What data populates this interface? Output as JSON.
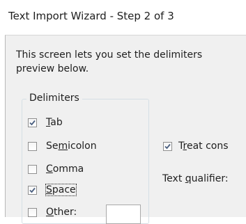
{
  "window": {
    "title": "Text Import Wizard - Step 2 of 3"
  },
  "intro": {
    "line1": "This screen lets you set the delimiters",
    "line2": "preview below."
  },
  "delimiters": {
    "group_label": "Delimiters",
    "items": [
      {
        "before": "",
        "mnemonic": "T",
        "after": "ab",
        "checked": true
      },
      {
        "before": "Se",
        "mnemonic": "m",
        "after": "icolon",
        "checked": false
      },
      {
        "before": "",
        "mnemonic": "C",
        "after": "omma",
        "checked": false
      },
      {
        "before": "",
        "mnemonic": "S",
        "after": "pace",
        "checked": true
      },
      {
        "before": "",
        "mnemonic": "O",
        "after": "ther:",
        "checked": false
      }
    ],
    "other_value": ""
  },
  "treat_consecutive": {
    "before": "T",
    "mnemonic": "r",
    "after": "eat cons",
    "checked": true
  },
  "text_qualifier": {
    "before": "Text ",
    "mnemonic": "q",
    "after": "ualifier:"
  },
  "colors": {
    "dialog_bg": "#f0f0f0",
    "title_bg": "#ffffff",
    "text": "#1e1e1e",
    "check": "#4a5f80"
  }
}
